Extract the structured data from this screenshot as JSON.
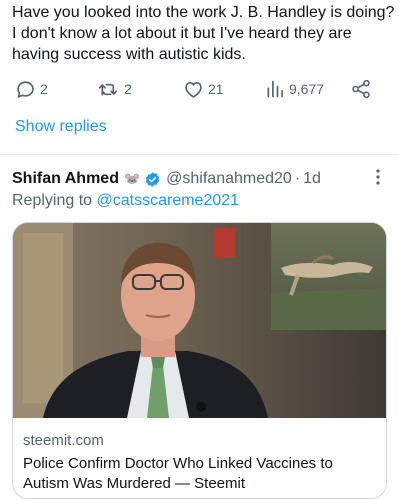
{
  "reply": {
    "text": "Have you looked into the work J. B. Handley is doing?\nI don't know a lot about it but I've heard they are\nhaving success with autistic kids.",
    "replies_count": "2",
    "retweets_count": "2",
    "likes_count": "21",
    "views_count": "9,677"
  },
  "show_replies_label": "Show replies",
  "tweet": {
    "author_name": "Shifan Ahmed",
    "author_emoji": "🐭",
    "handle": "@shifanahmed20",
    "separator": "·",
    "time": "1d",
    "replying_prefix": "Replying to ",
    "replying_handle": "@catsscareme2021",
    "card": {
      "domain": "steemit.com",
      "title": "Police Confirm Doctor Who Linked Vaccines to Autism Was Murdered — Steemit"
    }
  },
  "colors": {
    "accent": "#1d9bf0",
    "secondary_text": "#536471",
    "border": "#cfd9de"
  },
  "icons": [
    "reply-icon",
    "retweet-icon",
    "like-icon",
    "views-icon",
    "share-icon",
    "verified-badge-icon",
    "more-options-icon"
  ]
}
